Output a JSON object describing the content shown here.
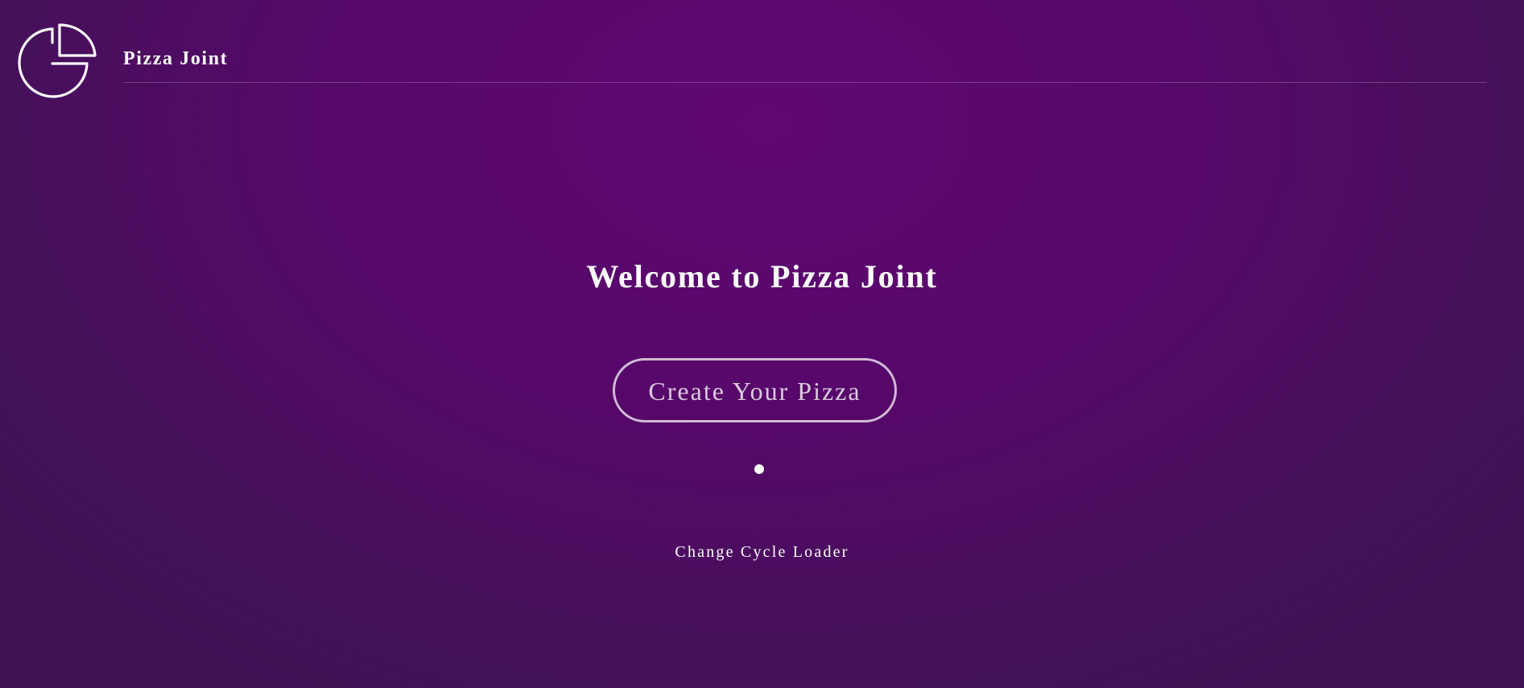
{
  "header": {
    "logo_icon": "pizza-slice-logo-icon",
    "brand_name": "Pizza Joint"
  },
  "main": {
    "welcome_title": "Welcome to Pizza Joint",
    "create_button_label": "Create Your Pizza",
    "loader_icon": "loader-dot-icon",
    "change_loader_label": "Change Cycle Loader"
  },
  "colors": {
    "background_center": "#600874",
    "background_edge": "#3e1253",
    "text": "#ffffff"
  }
}
